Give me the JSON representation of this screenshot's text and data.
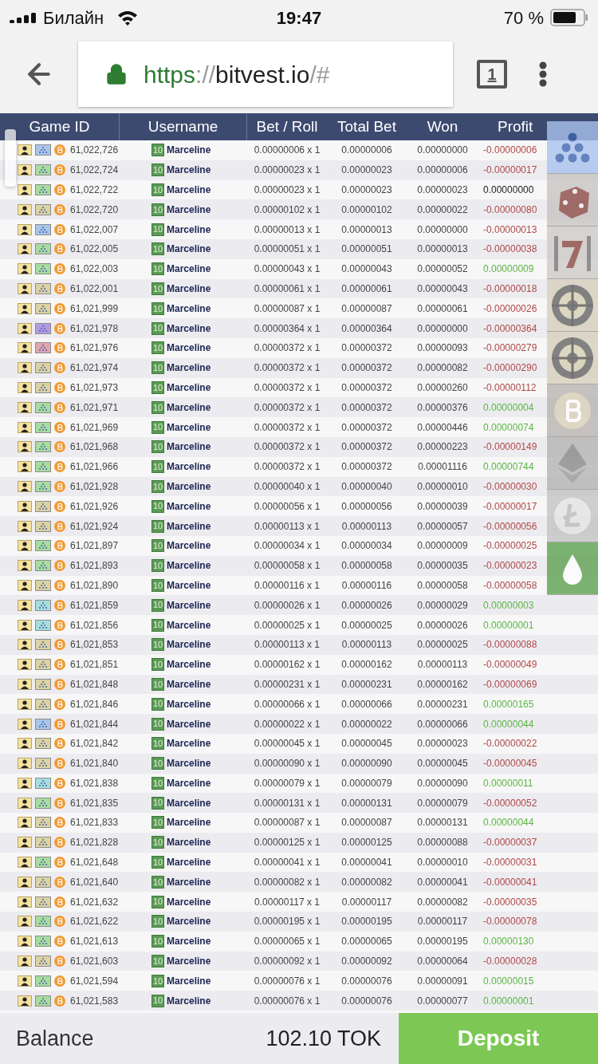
{
  "status_bar": {
    "carrier": "Билайн",
    "time": "19:47",
    "battery": "70 %"
  },
  "browser": {
    "url": {
      "scheme": "https",
      "separator": "://",
      "host": "bitvest.io",
      "path": "/#"
    },
    "tab_count": "1"
  },
  "table": {
    "columns": [
      "Game ID",
      "Username",
      "Bet / Roll",
      "Total Bet",
      "Won",
      "Profit"
    ],
    "rows": [
      {
        "game_id": "61,022,726",
        "color": "#a9c6ea",
        "rank": "10",
        "username": "Marceline",
        "bet_roll": "0.00000006 x 1",
        "total_bet": "0.00000006",
        "won": "0.00000000",
        "profit": "-0.00000006",
        "kind": "loss"
      },
      {
        "game_id": "61,022,724",
        "color": "#a8dca0",
        "rank": "10",
        "username": "Marceline",
        "bet_roll": "0.00000023 x 1",
        "total_bet": "0.00000023",
        "won": "0.00000006",
        "profit": "-0.00000017",
        "kind": "loss"
      },
      {
        "game_id": "61,022,722",
        "color": "#a8dca0",
        "rank": "10",
        "username": "Marceline",
        "bet_roll": "0.00000023 x 1",
        "total_bet": "0.00000023",
        "won": "0.00000023",
        "profit": "0.00000000",
        "kind": "even"
      },
      {
        "game_id": "61,022,720",
        "color": "#dcd2a2",
        "rank": "10",
        "username": "Marceline",
        "bet_roll": "0.00000102 x 1",
        "total_bet": "0.00000102",
        "won": "0.00000022",
        "profit": "-0.00000080",
        "kind": "loss"
      },
      {
        "game_id": "61,022,007",
        "color": "#a9c6ea",
        "rank": "10",
        "username": "Marceline",
        "bet_roll": "0.00000013 x 1",
        "total_bet": "0.00000013",
        "won": "0.00000000",
        "profit": "-0.00000013",
        "kind": "loss"
      },
      {
        "game_id": "61,022,005",
        "color": "#a8dca0",
        "rank": "10",
        "username": "Marceline",
        "bet_roll": "0.00000051 x 1",
        "total_bet": "0.00000051",
        "won": "0.00000013",
        "profit": "-0.00000038",
        "kind": "loss"
      },
      {
        "game_id": "61,022,003",
        "color": "#a8dca0",
        "rank": "10",
        "username": "Marceline",
        "bet_roll": "0.00000043 x 1",
        "total_bet": "0.00000043",
        "won": "0.00000052",
        "profit": "0.00000009",
        "kind": "win"
      },
      {
        "game_id": "61,022,001",
        "color": "#dcd2a2",
        "rank": "10",
        "username": "Marceline",
        "bet_roll": "0.00000061 x 1",
        "total_bet": "0.00000061",
        "won": "0.00000043",
        "profit": "-0.00000018",
        "kind": "loss"
      },
      {
        "game_id": "61,021,999",
        "color": "#dcd2a2",
        "rank": "10",
        "username": "Marceline",
        "bet_roll": "0.00000087 x 1",
        "total_bet": "0.00000087",
        "won": "0.00000061",
        "profit": "-0.00000026",
        "kind": "loss"
      },
      {
        "game_id": "61,021,978",
        "color": "#b39ae0",
        "rank": "10",
        "username": "Marceline",
        "bet_roll": "0.00000364 x 1",
        "total_bet": "0.00000364",
        "won": "0.00000000",
        "profit": "-0.00000364",
        "kind": "loss"
      },
      {
        "game_id": "61,021,976",
        "color": "#e0a6b0",
        "rank": "10",
        "username": "Marceline",
        "bet_roll": "0.00000372 x 1",
        "total_bet": "0.00000372",
        "won": "0.00000093",
        "profit": "-0.00000279",
        "kind": "loss"
      },
      {
        "game_id": "61,021,974",
        "color": "#dcd2a2",
        "rank": "10",
        "username": "Marceline",
        "bet_roll": "0.00000372 x 1",
        "total_bet": "0.00000372",
        "won": "0.00000082",
        "profit": "-0.00000290",
        "kind": "loss"
      },
      {
        "game_id": "61,021,973",
        "color": "#dcd2a2",
        "rank": "10",
        "username": "Marceline",
        "bet_roll": "0.00000372 x 1",
        "total_bet": "0.00000372",
        "won": "0.00000260",
        "profit": "-0.00000112",
        "kind": "loss"
      },
      {
        "game_id": "61,021,971",
        "color": "#a8dca0",
        "rank": "10",
        "username": "Marceline",
        "bet_roll": "0.00000372 x 1",
        "total_bet": "0.00000372",
        "won": "0.00000376",
        "profit": "0.00000004",
        "kind": "win"
      },
      {
        "game_id": "61,021,969",
        "color": "#a8dca0",
        "rank": "10",
        "username": "Marceline",
        "bet_roll": "0.00000372 x 1",
        "total_bet": "0.00000372",
        "won": "0.00000446",
        "profit": "0.00000074",
        "kind": "win"
      },
      {
        "game_id": "61,021,968",
        "color": "#a8dca0",
        "rank": "10",
        "username": "Marceline",
        "bet_roll": "0.00000372 x 1",
        "total_bet": "0.00000372",
        "won": "0.00000223",
        "profit": "-0.00000149",
        "kind": "loss"
      },
      {
        "game_id": "61,021,966",
        "color": "#a8dca0",
        "rank": "10",
        "username": "Marceline",
        "bet_roll": "0.00000372 x 1",
        "total_bet": "0.00000372",
        "won": "0.00001116",
        "profit": "0.00000744",
        "kind": "win"
      },
      {
        "game_id": "61,021,928",
        "color": "#a8dca0",
        "rank": "10",
        "username": "Marceline",
        "bet_roll": "0.00000040 x 1",
        "total_bet": "0.00000040",
        "won": "0.00000010",
        "profit": "-0.00000030",
        "kind": "loss"
      },
      {
        "game_id": "61,021,926",
        "color": "#dcd2a2",
        "rank": "10",
        "username": "Marceline",
        "bet_roll": "0.00000056 x 1",
        "total_bet": "0.00000056",
        "won": "0.00000039",
        "profit": "-0.00000017",
        "kind": "loss"
      },
      {
        "game_id": "61,021,924",
        "color": "#dcd2a2",
        "rank": "10",
        "username": "Marceline",
        "bet_roll": "0.00000113 x 1",
        "total_bet": "0.00000113",
        "won": "0.00000057",
        "profit": "-0.00000056",
        "kind": "loss"
      },
      {
        "game_id": "61,021,897",
        "color": "#a8dca0",
        "rank": "10",
        "username": "Marceline",
        "bet_roll": "0.00000034 x 1",
        "total_bet": "0.00000034",
        "won": "0.00000009",
        "profit": "-0.00000025",
        "kind": "loss"
      },
      {
        "game_id": "61,021,893",
        "color": "#a8dca0",
        "rank": "10",
        "username": "Marceline",
        "bet_roll": "0.00000058 x 1",
        "total_bet": "0.00000058",
        "won": "0.00000035",
        "profit": "-0.00000023",
        "kind": "loss"
      },
      {
        "game_id": "61,021,890",
        "color": "#dcd2a2",
        "rank": "10",
        "username": "Marceline",
        "bet_roll": "0.00000116 x 1",
        "total_bet": "0.00000116",
        "won": "0.00000058",
        "profit": "-0.00000058",
        "kind": "loss"
      },
      {
        "game_id": "61,021,859",
        "color": "#a6dede",
        "rank": "10",
        "username": "Marceline",
        "bet_roll": "0.00000026 x 1",
        "total_bet": "0.00000026",
        "won": "0.00000029",
        "profit": "0.00000003",
        "kind": "win"
      },
      {
        "game_id": "61,021,856",
        "color": "#a6dede",
        "rank": "10",
        "username": "Marceline",
        "bet_roll": "0.00000025 x 1",
        "total_bet": "0.00000025",
        "won": "0.00000026",
        "profit": "0.00000001",
        "kind": "win"
      },
      {
        "game_id": "61,021,853",
        "color": "#dcd2a2",
        "rank": "10",
        "username": "Marceline",
        "bet_roll": "0.00000113 x 1",
        "total_bet": "0.00000113",
        "won": "0.00000025",
        "profit": "-0.00000088",
        "kind": "loss"
      },
      {
        "game_id": "61,021,851",
        "color": "#dcd2a2",
        "rank": "10",
        "username": "Marceline",
        "bet_roll": "0.00000162 x 1",
        "total_bet": "0.00000162",
        "won": "0.00000113",
        "profit": "-0.00000049",
        "kind": "loss"
      },
      {
        "game_id": "61,021,848",
        "color": "#dcd2a2",
        "rank": "10",
        "username": "Marceline",
        "bet_roll": "0.00000231 x 1",
        "total_bet": "0.00000231",
        "won": "0.00000162",
        "profit": "-0.00000069",
        "kind": "loss"
      },
      {
        "game_id": "61,021,846",
        "color": "#dcd2a2",
        "rank": "10",
        "username": "Marceline",
        "bet_roll": "0.00000066 x 1",
        "total_bet": "0.00000066",
        "won": "0.00000231",
        "profit": "0.00000165",
        "kind": "win"
      },
      {
        "game_id": "61,021,844",
        "color": "#a9c6ea",
        "rank": "10",
        "username": "Marceline",
        "bet_roll": "0.00000022 x 1",
        "total_bet": "0.00000022",
        "won": "0.00000066",
        "profit": "0.00000044",
        "kind": "win"
      },
      {
        "game_id": "61,021,842",
        "color": "#dcd2a2",
        "rank": "10",
        "username": "Marceline",
        "bet_roll": "0.00000045 x 1",
        "total_bet": "0.00000045",
        "won": "0.00000023",
        "profit": "-0.00000022",
        "kind": "loss"
      },
      {
        "game_id": "61,021,840",
        "color": "#dcd2a2",
        "rank": "10",
        "username": "Marceline",
        "bet_roll": "0.00000090 x 1",
        "total_bet": "0.00000090",
        "won": "0.00000045",
        "profit": "-0.00000045",
        "kind": "loss"
      },
      {
        "game_id": "61,021,838",
        "color": "#a6dede",
        "rank": "10",
        "username": "Marceline",
        "bet_roll": "0.00000079 x 1",
        "total_bet": "0.00000079",
        "won": "0.00000090",
        "profit": "0.00000011",
        "kind": "win"
      },
      {
        "game_id": "61,021,835",
        "color": "#a8dca0",
        "rank": "10",
        "username": "Marceline",
        "bet_roll": "0.00000131 x 1",
        "total_bet": "0.00000131",
        "won": "0.00000079",
        "profit": "-0.00000052",
        "kind": "loss"
      },
      {
        "game_id": "61,021,833",
        "color": "#dcd2a2",
        "rank": "10",
        "username": "Marceline",
        "bet_roll": "0.00000087 x 1",
        "total_bet": "0.00000087",
        "won": "0.00000131",
        "profit": "0.00000044",
        "kind": "win"
      },
      {
        "game_id": "61,021,828",
        "color": "#dcd2a2",
        "rank": "10",
        "username": "Marceline",
        "bet_roll": "0.00000125 x 1",
        "total_bet": "0.00000125",
        "won": "0.00000088",
        "profit": "-0.00000037",
        "kind": "loss"
      },
      {
        "game_id": "61,021,648",
        "color": "#a8dca0",
        "rank": "10",
        "username": "Marceline",
        "bet_roll": "0.00000041 x 1",
        "total_bet": "0.00000041",
        "won": "0.00000010",
        "profit": "-0.00000031",
        "kind": "loss"
      },
      {
        "game_id": "61,021,640",
        "color": "#dcd2a2",
        "rank": "10",
        "username": "Marceline",
        "bet_roll": "0.00000082 x 1",
        "total_bet": "0.00000082",
        "won": "0.00000041",
        "profit": "-0.00000041",
        "kind": "loss"
      },
      {
        "game_id": "61,021,632",
        "color": "#dcd2a2",
        "rank": "10",
        "username": "Marceline",
        "bet_roll": "0.00000117 x 1",
        "total_bet": "0.00000117",
        "won": "0.00000082",
        "profit": "-0.00000035",
        "kind": "loss"
      },
      {
        "game_id": "61,021,622",
        "color": "#a8dca0",
        "rank": "10",
        "username": "Marceline",
        "bet_roll": "0.00000195 x 1",
        "total_bet": "0.00000195",
        "won": "0.00000117",
        "profit": "-0.00000078",
        "kind": "loss"
      },
      {
        "game_id": "61,021,613",
        "color": "#a8dca0",
        "rank": "10",
        "username": "Marceline",
        "bet_roll": "0.00000065 x 1",
        "total_bet": "0.00000065",
        "won": "0.00000195",
        "profit": "0.00000130",
        "kind": "win"
      },
      {
        "game_id": "61,021,603",
        "color": "#dcd2a2",
        "rank": "10",
        "username": "Marceline",
        "bet_roll": "0.00000092 x 1",
        "total_bet": "0.00000092",
        "won": "0.00000064",
        "profit": "-0.00000028",
        "kind": "loss"
      },
      {
        "game_id": "61,021,594",
        "color": "#a8dca0",
        "rank": "10",
        "username": "Marceline",
        "bet_roll": "0.00000076 x 1",
        "total_bet": "0.00000076",
        "won": "0.00000091",
        "profit": "0.00000015",
        "kind": "win"
      },
      {
        "game_id": "61,021,583",
        "color": "#a8dca0",
        "rank": "10",
        "username": "Marceline",
        "bet_roll": "0.00000076 x 1",
        "total_bet": "0.00000076",
        "won": "0.00000077",
        "profit": "0.00000001",
        "kind": "win"
      }
    ]
  },
  "side_buttons": [
    {
      "kind": "dots"
    },
    {
      "kind": "dice"
    },
    {
      "kind": "slots"
    },
    {
      "kind": "roulette"
    },
    {
      "kind": "wheel"
    },
    {
      "kind": "bitcoin"
    },
    {
      "kind": "ethereum"
    },
    {
      "kind": "litecoin"
    },
    {
      "kind": "faucet"
    }
  ],
  "footer": {
    "balance_label": "Balance",
    "balance": "102.10 TOK",
    "deposit": "Deposit"
  }
}
